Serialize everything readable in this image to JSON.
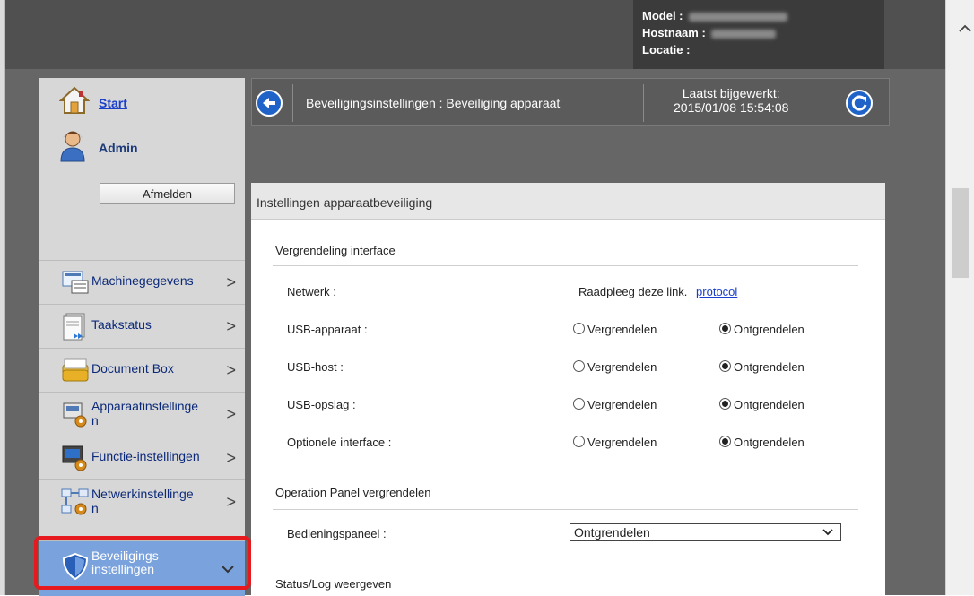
{
  "device": {
    "model_label": "Model :",
    "hostname_label": "Hostnaam :",
    "location_label": "Locatie :"
  },
  "sidebar": {
    "start_label": "Start",
    "user_label": "Admin",
    "logout_label": "Afmelden",
    "items": [
      {
        "label": "Machinegegevens",
        "icon": "machine-info-icon"
      },
      {
        "label": "Taakstatus",
        "icon": "job-status-icon"
      },
      {
        "label": "Document Box",
        "icon": "document-box-icon"
      },
      {
        "label": "Apparaatinstellinge\nn",
        "icon": "device-settings-icon"
      },
      {
        "label": "Functie-instellingen",
        "icon": "function-settings-icon"
      },
      {
        "label": "Netwerkinstellinge\nn",
        "icon": "network-settings-icon"
      },
      {
        "label": "Beveiligings\ninstellingen",
        "icon": "security-shield-icon",
        "active": true
      }
    ]
  },
  "header": {
    "breadcrumb": "Beveiligingsinstellingen : Beveiliging apparaat",
    "last_updated_label": "Laatst bijgewerkt:",
    "last_updated_value": "2015/01/08 15:54:08"
  },
  "panel": {
    "title": "Instellingen apparaatbeveiliging",
    "section_interface": "Vergrendeling interface",
    "network_label": "Netwerk :",
    "network_text": "Raadpleeg deze link.",
    "network_link": "protocol",
    "rows": [
      {
        "label": "USB-apparaat :",
        "opt_lock": "Vergrendelen",
        "opt_unlock": "Ontgrendelen",
        "selected": "unlock"
      },
      {
        "label": "USB-host :",
        "opt_lock": "Vergrendelen",
        "opt_unlock": "Ontgrendelen",
        "selected": "unlock"
      },
      {
        "label": "USB-opslag :",
        "opt_lock": "Vergrendelen",
        "opt_unlock": "Ontgrendelen",
        "selected": "unlock"
      },
      {
        "label": "Optionele interface :",
        "opt_lock": "Vergrendelen",
        "opt_unlock": "Ontgrendelen",
        "selected": "unlock"
      }
    ],
    "section_panel": "Operation Panel vergrendelen",
    "panel_lock_label": "Bedieningspaneel :",
    "panel_lock_value": "Ontgrendelen",
    "section_status": "Status/Log weergeven"
  },
  "colors": {
    "active_nav": "#7aa2dc",
    "link": "#1a3ecc",
    "highlight": "#e5191e"
  }
}
